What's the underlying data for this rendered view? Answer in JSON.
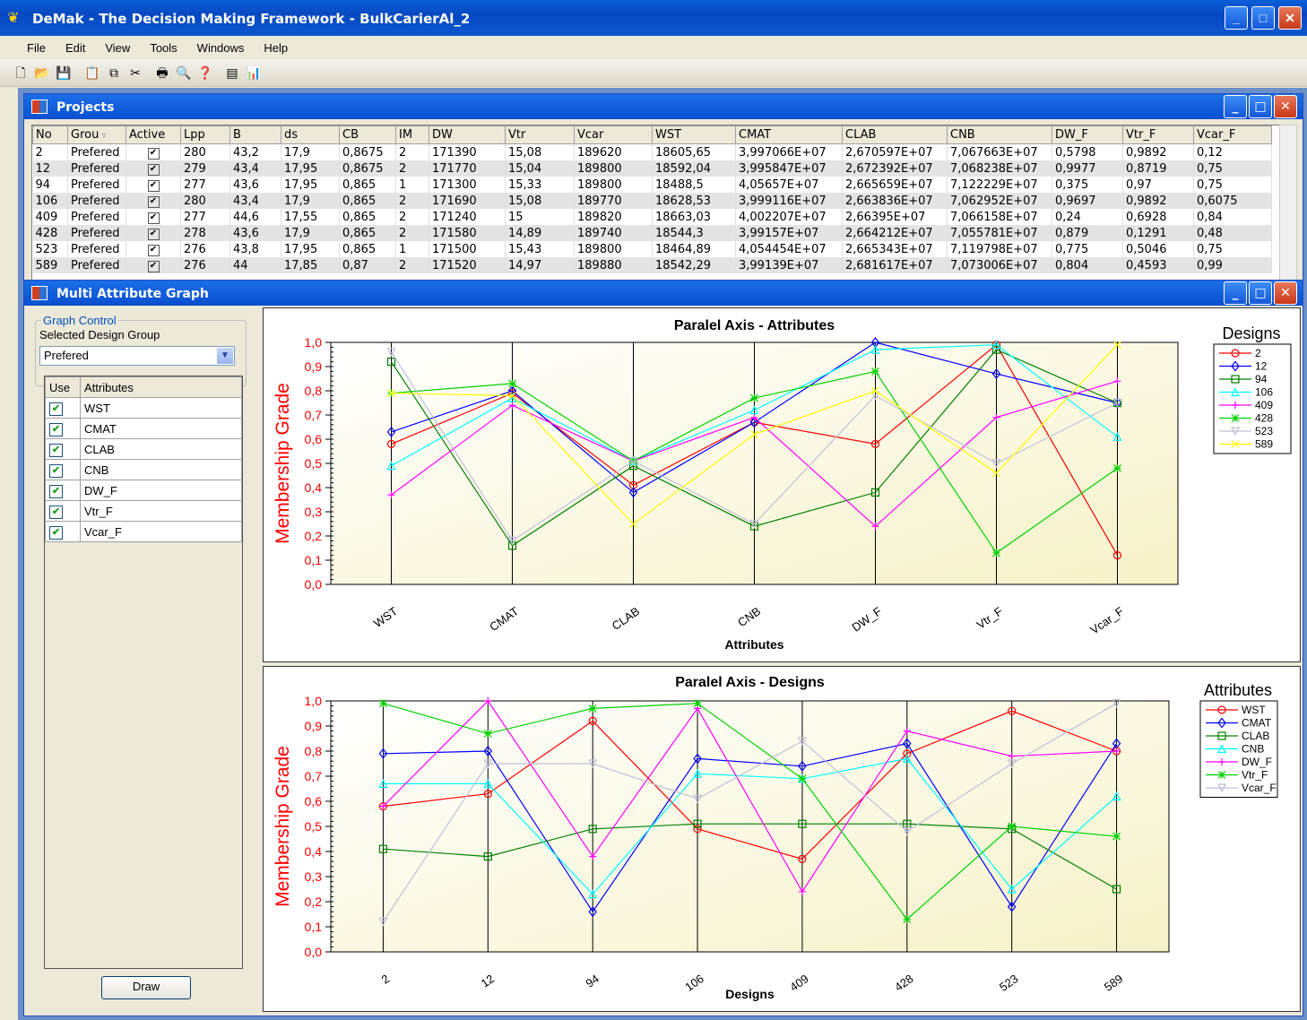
{
  "app": {
    "title": "DeMak - The Decision Making Framework - BulkCarierAl_2",
    "menu": [
      "File",
      "Edit",
      "View",
      "Tools",
      "Windows",
      "Help"
    ]
  },
  "projects_window": {
    "title": "Projects",
    "columns": [
      "No",
      "Grou",
      "Active",
      "Lpp",
      "B",
      "ds",
      "CB",
      "IM",
      "DW",
      "Vtr",
      "Vcar",
      "WST",
      "CMAT",
      "CLAB",
      "CNB",
      "DW_F",
      "Vtr_F",
      "Vcar_F"
    ],
    "rows": [
      [
        "2",
        "Prefered",
        "✔",
        "280",
        "43,2",
        "17,9",
        "0,8675",
        "2",
        "171390",
        "15,08",
        "189620",
        "18605,65",
        "3,997066E+07",
        "2,670597E+07",
        "7,067663E+07",
        "0,5798",
        "0,9892",
        "0,12"
      ],
      [
        "12",
        "Prefered",
        "✔",
        "279",
        "43,4",
        "17,95",
        "0,8675",
        "2",
        "171770",
        "15,04",
        "189800",
        "18592,04",
        "3,995847E+07",
        "2,672392E+07",
        "7,068238E+07",
        "0,9977",
        "0,8719",
        "0,75"
      ],
      [
        "94",
        "Prefered",
        "✔",
        "277",
        "43,6",
        "17,95",
        "0,865",
        "1",
        "171300",
        "15,33",
        "189800",
        "18488,5",
        "4,05657E+07",
        "2,665659E+07",
        "7,122229E+07",
        "0,375",
        "0,97",
        "0,75"
      ],
      [
        "106",
        "Prefered",
        "✔",
        "280",
        "43,4",
        "17,9",
        "0,865",
        "2",
        "171690",
        "15,08",
        "189770",
        "18628,53",
        "3,999116E+07",
        "2,663836E+07",
        "7,062952E+07",
        "0,9697",
        "0,9892",
        "0,6075"
      ],
      [
        "409",
        "Prefered",
        "✔",
        "277",
        "44,6",
        "17,55",
        "0,865",
        "2",
        "171240",
        "15",
        "189820",
        "18663,03",
        "4,002207E+07",
        "2,66395E+07",
        "7,066158E+07",
        "0,24",
        "0,6928",
        "0,84"
      ],
      [
        "428",
        "Prefered",
        "✔",
        "278",
        "43,6",
        "17,9",
        "0,865",
        "2",
        "171580",
        "14,89",
        "189740",
        "18544,3",
        "3,99157E+07",
        "2,664212E+07",
        "7,055781E+07",
        "0,879",
        "0,1291",
        "0,48"
      ],
      [
        "523",
        "Prefered",
        "✔",
        "276",
        "43,8",
        "17,95",
        "0,865",
        "1",
        "171500",
        "15,43",
        "189800",
        "18464,89",
        "4,054454E+07",
        "2,665343E+07",
        "7,119798E+07",
        "0,775",
        "0,5046",
        "0,75"
      ],
      [
        "589",
        "Prefered",
        "✔",
        "276",
        "44",
        "17,85",
        "0,87",
        "2",
        "171520",
        "14,97",
        "189880",
        "18542,29",
        "3,99139E+07",
        "2,681617E+07",
        "7,073006E+07",
        "0,804",
        "0,4593",
        "0,99"
      ]
    ]
  },
  "mag_window": {
    "title": "Multi Attribute Graph",
    "graph_control": "Graph Control",
    "selected_group_label": "Selected Design Group",
    "selected_group_value": "Prefered",
    "attr_headers": [
      "Use",
      "Attributes"
    ],
    "attributes": [
      "WST",
      "CMAT",
      "CLAB",
      "CNB",
      "DW_F",
      "Vtr_F",
      "Vcar_F"
    ],
    "draw_label": "Draw"
  },
  "chart_data": [
    {
      "type": "line",
      "title": "Paralel Axis - Attributes",
      "xlabel": "Attributes",
      "ylabel": "Membership Grade",
      "legend_title": "Designs",
      "legend_position": "right",
      "categories": [
        "WST",
        "CMAT",
        "CLAB",
        "CNB",
        "DW_F",
        "Vtr_F",
        "Vcar_F"
      ],
      "yticks": [
        "0,0",
        "0,1",
        "0,2",
        "0,3",
        "0,4",
        "0,5",
        "0,6",
        "0,7",
        "0,8",
        "0,9",
        "1,0"
      ],
      "ylim": [
        0,
        1
      ],
      "series": [
        {
          "name": "2",
          "color": "#ff0000",
          "marker": "circle",
          "values": [
            0.58,
            0.79,
            0.41,
            0.67,
            0.58,
            0.99,
            0.12
          ]
        },
        {
          "name": "12",
          "color": "#0000ff",
          "marker": "diamond",
          "values": [
            0.63,
            0.8,
            0.38,
            0.67,
            1.0,
            0.87,
            0.75
          ]
        },
        {
          "name": "94",
          "color": "#008000",
          "marker": "square",
          "values": [
            0.92,
            0.16,
            0.49,
            0.24,
            0.38,
            0.97,
            0.75
          ]
        },
        {
          "name": "106",
          "color": "#00ffff",
          "marker": "triangle",
          "values": [
            0.49,
            0.77,
            0.51,
            0.72,
            0.97,
            0.99,
            0.61
          ]
        },
        {
          "name": "409",
          "color": "#ff00ff",
          "marker": "plus",
          "values": [
            0.37,
            0.74,
            0.51,
            0.69,
            0.24,
            0.69,
            0.84
          ]
        },
        {
          "name": "428",
          "color": "#00d000",
          "marker": "star",
          "values": [
            0.79,
            0.83,
            0.51,
            0.77,
            0.88,
            0.13,
            0.48
          ]
        },
        {
          "name": "523",
          "color": "#c0c0d8",
          "marker": "tri-down",
          "values": [
            0.96,
            0.18,
            0.51,
            0.25,
            0.78,
            0.5,
            0.75
          ]
        },
        {
          "name": "589",
          "color": "#ffff00",
          "marker": "cross",
          "values": [
            0.79,
            0.78,
            0.25,
            0.62,
            0.8,
            0.46,
            0.99
          ]
        }
      ]
    },
    {
      "type": "line",
      "title": "Paralel Axis - Designs",
      "xlabel": "Designs",
      "ylabel": "Membership Grade",
      "legend_title": "Attributes",
      "legend_position": "right",
      "categories": [
        "2",
        "12",
        "94",
        "106",
        "409",
        "428",
        "523",
        "589"
      ],
      "yticks": [
        "0,0",
        "0,1",
        "0,2",
        "0,3",
        "0,4",
        "0,5",
        "0,6",
        "0,7",
        "0,8",
        "0,9",
        "1,0"
      ],
      "ylim": [
        0,
        1
      ],
      "series": [
        {
          "name": "WST",
          "color": "#ff0000",
          "marker": "circle",
          "values": [
            0.58,
            0.63,
            0.92,
            0.49,
            0.37,
            0.79,
            0.96,
            0.8
          ]
        },
        {
          "name": "CMAT",
          "color": "#0000ff",
          "marker": "diamond",
          "values": [
            0.79,
            0.8,
            0.16,
            0.77,
            0.74,
            0.83,
            0.18,
            0.83
          ]
        },
        {
          "name": "CLAB",
          "color": "#008000",
          "marker": "square",
          "values": [
            0.41,
            0.38,
            0.49,
            0.51,
            0.51,
            0.51,
            0.49,
            0.25
          ]
        },
        {
          "name": "CNB",
          "color": "#00ffff",
          "marker": "triangle",
          "values": [
            0.67,
            0.67,
            0.23,
            0.71,
            0.69,
            0.77,
            0.25,
            0.62
          ]
        },
        {
          "name": "DW_F",
          "color": "#ff00ff",
          "marker": "plus",
          "values": [
            0.58,
            1.0,
            0.38,
            0.97,
            0.24,
            0.88,
            0.78,
            0.8
          ]
        },
        {
          "name": "Vtr_F",
          "color": "#00d000",
          "marker": "star",
          "values": [
            0.99,
            0.87,
            0.97,
            0.99,
            0.69,
            0.13,
            0.5,
            0.46
          ]
        },
        {
          "name": "Vcar_F",
          "color": "#c0c0d8",
          "marker": "tri-down",
          "values": [
            0.12,
            0.75,
            0.75,
            0.61,
            0.84,
            0.48,
            0.75,
            0.99
          ]
        }
      ]
    }
  ]
}
